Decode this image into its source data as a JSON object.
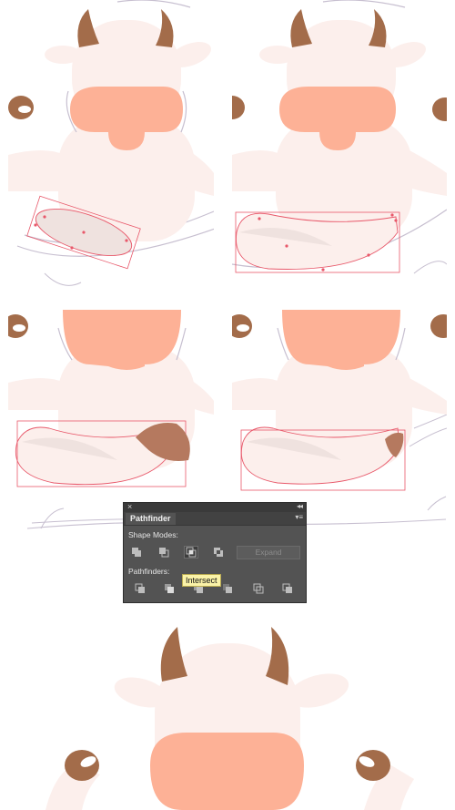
{
  "pathfinder": {
    "close_glyph": "×",
    "collapse_glyph": "◂◂",
    "tab_label": "Pathfinder",
    "menu_glyph": "▾≡",
    "shape_modes_label": "Shape Modes:",
    "pathfinders_label": "Pathfinders:",
    "expand_label": "Expand",
    "tooltip": "Intersect",
    "shape_mode_buttons": [
      "unite-icon",
      "minus-front-icon",
      "intersect-icon",
      "exclude-icon"
    ],
    "pathfinder_buttons": [
      "divide-icon",
      "trim-icon",
      "merge-icon",
      "crop-icon",
      "outline-icon",
      "minus-back-icon"
    ],
    "active_button": "intersect-icon"
  },
  "colors": {
    "body": "#fcefec",
    "muzzle": "#fdb196",
    "horn": "#a36c4a",
    "tail_tip": "#b5795f",
    "selection": "#e8586a",
    "guide_sketch": "#c7bfd0",
    "panel_bg": "#535353"
  }
}
